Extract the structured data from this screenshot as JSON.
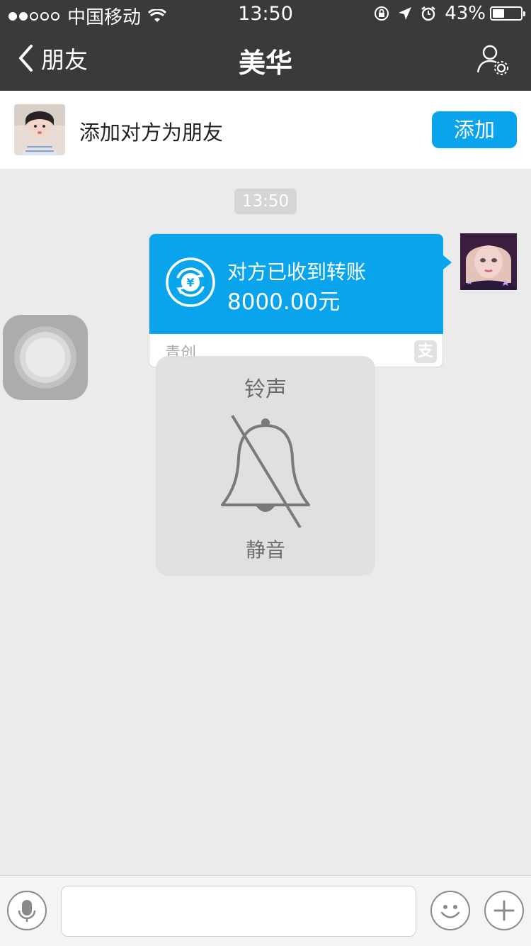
{
  "status_bar": {
    "carrier": "中国移动",
    "time": "13:50",
    "battery_percent": "43%",
    "battery_level": 0.43,
    "signal_bars_filled": 2,
    "signal_bars_total": 5,
    "icons": [
      "wifi-icon",
      "orientation-lock-icon",
      "location-icon",
      "alarm-icon"
    ]
  },
  "nav": {
    "back_label": "朋友",
    "title": "美华",
    "profile_icon": "user-settings-icon"
  },
  "add_friend": {
    "text": "添加对方为朋友",
    "button_label": "添加"
  },
  "chat": {
    "timestamp": "13:50",
    "message": {
      "line1": "对方已收到转账",
      "line2": "8000.00元",
      "footer": "青创",
      "badge": "支",
      "icon": "yuan-transfer-icon"
    }
  },
  "hud": {
    "title": "铃声",
    "label": "静音",
    "icon": "bell-muted-icon"
  },
  "input_bar": {
    "placeholder": "",
    "voice_icon": "microphone-icon",
    "emoji_icon": "smiley-icon",
    "plus_icon": "plus-icon"
  },
  "colors": {
    "nav_bg": "#3a3a3a",
    "accent": "#0aa4ec",
    "chat_bg": "#ebebeb"
  }
}
